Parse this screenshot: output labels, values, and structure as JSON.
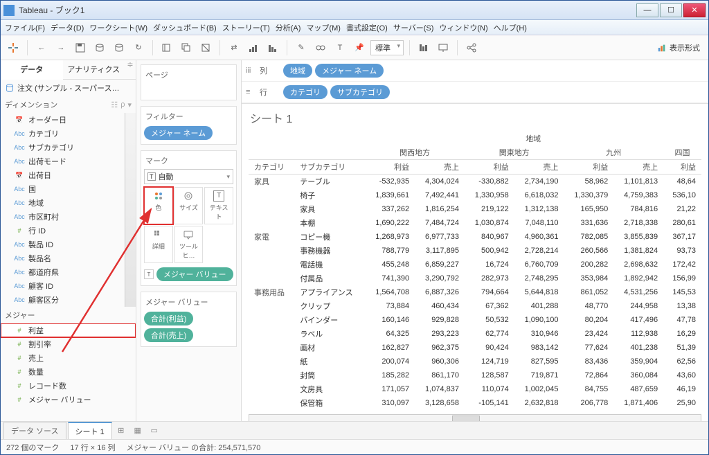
{
  "window": {
    "title": "Tableau - ブック1"
  },
  "menus": [
    "ファイル(F)",
    "データ(D)",
    "ワークシート(W)",
    "ダッシュボード(B)",
    "ストーリー(T)",
    "分析(A)",
    "マップ(M)",
    "書式設定(O)",
    "サーバー(S)",
    "ウィンドウ(N)",
    "ヘルプ(H)"
  ],
  "toolbar": {
    "std_label": "標準",
    "show_me": "表示形式"
  },
  "left_tabs": {
    "data": "データ",
    "analytics": "アナリティクス"
  },
  "datasource": {
    "name": "注文 (サンプル - スーパース…"
  },
  "sections": {
    "dimensions": "ディメンション",
    "measures": "メジャー"
  },
  "dims": [
    {
      "t": "date",
      "n": "オーダー日"
    },
    {
      "t": "abc",
      "n": "カテゴリ"
    },
    {
      "t": "abc",
      "n": "サブカテゴリ"
    },
    {
      "t": "abc",
      "n": "出荷モード"
    },
    {
      "t": "date",
      "n": "出荷日"
    },
    {
      "t": "abc",
      "n": "国"
    },
    {
      "t": "abc",
      "n": "地域"
    },
    {
      "t": "abc",
      "n": "市区町村"
    },
    {
      "t": "num",
      "n": "行 ID"
    },
    {
      "t": "abc",
      "n": "製品 ID"
    },
    {
      "t": "abc",
      "n": "製品名"
    },
    {
      "t": "abc",
      "n": "都道府県"
    },
    {
      "t": "abc",
      "n": "顧客 ID"
    },
    {
      "t": "abc",
      "n": "顧客区分"
    },
    {
      "t": "abc",
      "n": "顧客名"
    },
    {
      "t": "abc",
      "n": "メジャー ネーム"
    }
  ],
  "meas": [
    {
      "t": "num",
      "n": "利益",
      "hl": true
    },
    {
      "t": "num",
      "n": "割引率"
    },
    {
      "t": "num",
      "n": "売上"
    },
    {
      "t": "num",
      "n": "数量"
    },
    {
      "t": "num",
      "n": "レコード数"
    },
    {
      "t": "num",
      "n": "メジャー バリュー"
    }
  ],
  "mid": {
    "pages": "ページ",
    "filters": "フィルター",
    "filter_pill": "メジャー ネーム",
    "marks": "マーク",
    "mark_type": "自動",
    "cells": {
      "color": "色",
      "size": "サイズ",
      "text": "テキスト",
      "detail": "詳細",
      "tooltip": "ツールヒ…"
    },
    "mark_pill": "メジャー バリュー",
    "mv_title": "メジャー バリュー",
    "mv_pills": [
      "合計(利益)",
      "合計(売上)"
    ]
  },
  "shelves": {
    "cols_label": "列",
    "rows_label": "行",
    "col_pills": [
      "地域",
      "メジャー ネーム"
    ],
    "row_pills": [
      "カテゴリ",
      "サブカテゴリ"
    ]
  },
  "sheet": {
    "title": "シート 1"
  },
  "table": {
    "region_header": "地域",
    "regions": [
      "関西地方",
      "関東地方",
      "九州",
      "四国"
    ],
    "sub_headers": [
      "利益",
      "売上"
    ],
    "cat_hdr": "カテゴリ",
    "subcat_hdr": "サブカテゴリ",
    "groups": [
      {
        "cat": "家具",
        "rows": [
          {
            "s": "テーブル",
            "v": [
              "-532,935",
              "4,304,024",
              "-330,882",
              "2,734,190",
              "58,962",
              "1,101,813",
              "48,64"
            ]
          },
          {
            "s": "椅子",
            "v": [
              "1,839,661",
              "7,492,441",
              "1,330,958",
              "6,618,032",
              "1,330,379",
              "4,759,383",
              "536,10"
            ]
          },
          {
            "s": "家具",
            "v": [
              "337,262",
              "1,816,254",
              "219,122",
              "1,312,138",
              "165,950",
              "784,816",
              "21,22"
            ]
          },
          {
            "s": "本棚",
            "v": [
              "1,690,222",
              "7,484,724",
              "1,030,874",
              "7,048,110",
              "331,636",
              "2,718,338",
              "280,61"
            ]
          }
        ]
      },
      {
        "cat": "家電",
        "rows": [
          {
            "s": "コピー機",
            "v": [
              "1,268,973",
              "6,977,733",
              "840,967",
              "4,960,361",
              "782,085",
              "3,855,839",
              "367,17"
            ]
          },
          {
            "s": "事務機器",
            "v": [
              "788,779",
              "3,117,895",
              "500,942",
              "2,728,214",
              "260,566",
              "1,381,824",
              "93,73"
            ]
          },
          {
            "s": "電話機",
            "v": [
              "455,248",
              "6,859,227",
              "16,724",
              "6,760,709",
              "200,282",
              "2,698,632",
              "172,42"
            ]
          },
          {
            "s": "付属品",
            "v": [
              "741,390",
              "3,290,792",
              "282,973",
              "2,748,295",
              "353,984",
              "1,892,942",
              "156,99"
            ]
          }
        ]
      },
      {
        "cat": "事務用品",
        "rows": [
          {
            "s": "アプライアンス",
            "v": [
              "1,564,708",
              "6,887,326",
              "794,664",
              "5,644,818",
              "861,052",
              "4,531,256",
              "145,53"
            ]
          },
          {
            "s": "クリップ",
            "v": [
              "73,884",
              "460,434",
              "67,362",
              "401,288",
              "48,770",
              "244,958",
              "13,38"
            ]
          },
          {
            "s": "バインダー",
            "v": [
              "160,146",
              "929,828",
              "50,532",
              "1,090,100",
              "80,204",
              "417,496",
              "47,78"
            ]
          },
          {
            "s": "ラベル",
            "v": [
              "64,325",
              "293,223",
              "62,774",
              "310,946",
              "23,424",
              "112,938",
              "16,29"
            ]
          },
          {
            "s": "画材",
            "v": [
              "162,827",
              "962,375",
              "90,424",
              "983,142",
              "77,624",
              "401,238",
              "51,39"
            ]
          },
          {
            "s": "紙",
            "v": [
              "200,074",
              "960,306",
              "124,719",
              "827,595",
              "83,436",
              "359,904",
              "62,56"
            ]
          },
          {
            "s": "封筒",
            "v": [
              "185,282",
              "861,170",
              "128,587",
              "719,871",
              "72,864",
              "360,084",
              "43,60"
            ]
          },
          {
            "s": "文房具",
            "v": [
              "171,057",
              "1,074,837",
              "110,074",
              "1,002,045",
              "84,755",
              "487,659",
              "46,19"
            ]
          },
          {
            "s": "保管箱",
            "v": [
              "310,097",
              "3,128,658",
              "-105,141",
              "2,632,818",
              "206,778",
              "1,871,406",
              "25,90"
            ]
          }
        ]
      }
    ]
  },
  "bottom": {
    "ds": "データ ソース",
    "sheet": "シート 1"
  },
  "status": {
    "marks": "272 個のマーク",
    "dims": "17 行 × 16 列",
    "agg": "メジャー バリュー の合計: 254,571,570"
  }
}
